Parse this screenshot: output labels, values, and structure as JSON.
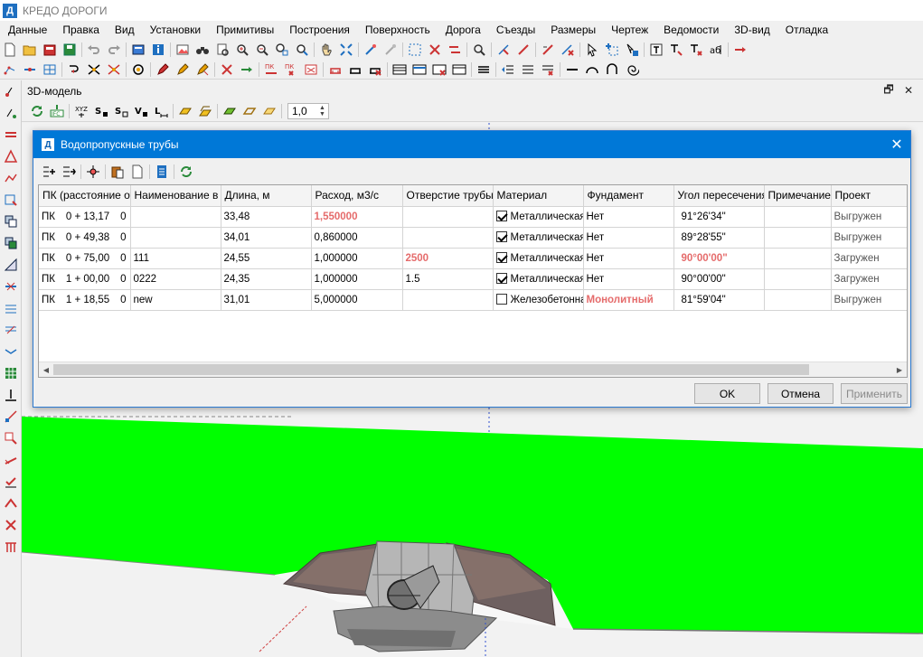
{
  "app": {
    "title": "КРЕДО ДОРОГИ",
    "logo_letter": "Д"
  },
  "menu": [
    "Данные",
    "Правка",
    "Вид",
    "Установки",
    "Примитивы",
    "Построения",
    "Поверхность",
    "Дорога",
    "Съезды",
    "Размеры",
    "Чертеж",
    "Ведомости",
    "3D-вид",
    "Отладка"
  ],
  "panel": {
    "title": "3D-модель",
    "scale_value": "1,0"
  },
  "dialog": {
    "title": "Водопропускные трубы",
    "logo_letter": "Д",
    "columns": [
      "ПК (расстояние от начала трассы)",
      "Наименование в ведомости",
      "Длина, м",
      "Расход, м3/с",
      "Отверстие трубы",
      "Материал",
      "Фундамент",
      "Угол пересечения",
      "Примечание",
      "Проект"
    ],
    "rows": [
      {
        "pk_prefix": "ПК",
        "pk": "0 + 13,17",
        "pk_suffix": "0",
        "name": "",
        "length": "33,48",
        "flow": "1,550000",
        "flow_highlight": true,
        "opening": "",
        "opening_highlight": false,
        "material_checked": true,
        "material": "Металлическая",
        "foundation": "Нет",
        "foundation_highlight": false,
        "angle": "91°26'34\"",
        "angle_highlight": false,
        "note": "",
        "project": "Выгружен"
      },
      {
        "pk_prefix": "ПК",
        "pk": "0 + 49,38",
        "pk_suffix": "0",
        "name": "",
        "length": "34,01",
        "flow": "0,860000",
        "flow_highlight": false,
        "opening": "",
        "opening_highlight": false,
        "material_checked": true,
        "material": "Металлическая",
        "foundation": "Нет",
        "foundation_highlight": false,
        "angle": "89°28'55\"",
        "angle_highlight": false,
        "note": "",
        "project": "Выгружен"
      },
      {
        "pk_prefix": "ПК",
        "pk": "0 + 75,00",
        "pk_suffix": "0",
        "name": "111",
        "length": "24,55",
        "flow": "1,000000",
        "flow_highlight": false,
        "opening": "2500",
        "opening_highlight": true,
        "material_checked": true,
        "material": "Металлическая",
        "foundation": "Нет",
        "foundation_highlight": false,
        "angle": "90°00'00\"",
        "angle_highlight": true,
        "note": "",
        "project": "Загружен"
      },
      {
        "pk_prefix": "ПК",
        "pk": "1 + 00,00",
        "pk_suffix": "0",
        "name": "0222",
        "length": "24,35",
        "flow": "1,000000",
        "flow_highlight": false,
        "opening": "1.5",
        "opening_highlight": false,
        "material_checked": true,
        "material": "Металлическая",
        "foundation": "Нет",
        "foundation_highlight": false,
        "angle": "90°00'00\"",
        "angle_highlight": false,
        "note": "",
        "project": "Загружен"
      },
      {
        "pk_prefix": "ПК",
        "pk": "1 + 18,55",
        "pk_suffix": "0",
        "name": "new",
        "length": "31,01",
        "flow": "5,000000",
        "flow_highlight": false,
        "opening": "",
        "opening_highlight": false,
        "material_checked": false,
        "material": "Железобетонная",
        "foundation": "Монолитный",
        "foundation_highlight": true,
        "angle": "81°59'04\"",
        "angle_highlight": false,
        "note": "",
        "project": "Выгружен"
      }
    ],
    "buttons": {
      "ok": "OK",
      "cancel": "Отмена",
      "apply": "Применить"
    }
  },
  "colors": {
    "accent": "#0078d7",
    "highlight": "#e56b6b",
    "terrain": "#00ff00"
  }
}
